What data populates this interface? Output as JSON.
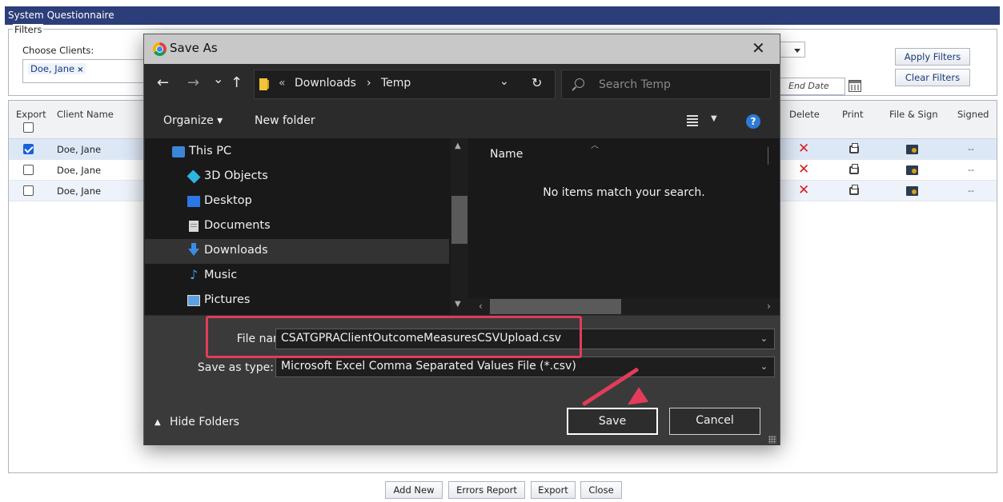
{
  "app": {
    "title": "System Questionnaire",
    "filters_legend": "Filters",
    "choose_clients_label": "Choose Clients:",
    "client_chip": "Doe, Jane",
    "chip_remove": "×",
    "end_date_placeholder": "End Date",
    "apply_filters": "Apply Filters",
    "clear_filters": "Clear Filters"
  },
  "grid": {
    "headers": {
      "export": "Export",
      "client_name": "Client Name",
      "delete": "Delete",
      "print": "Print",
      "file_sign": "File & Sign",
      "signed": "Signed"
    },
    "rows": [
      {
        "name": "Doe, Jane",
        "checked": true,
        "signed": "--"
      },
      {
        "name": "Doe, Jane",
        "checked": false,
        "signed": "--"
      },
      {
        "name": "Doe, Jane",
        "checked": false,
        "signed": "--"
      }
    ],
    "delete_glyph": "✕"
  },
  "bottom_buttons": {
    "add_new": "Add New",
    "errors_report": "Errors Report",
    "export": "Export",
    "close": "Close"
  },
  "dialog": {
    "title": "Save As",
    "close_glyph": "✕",
    "nav": {
      "back": "←",
      "forward": "→",
      "recent": "⌄",
      "up": "↑"
    },
    "breadcrumb": {
      "prefix": "«",
      "parts": [
        "Downloads",
        "Temp"
      ],
      "separator": "›"
    },
    "refresh_glyph": "↻",
    "address_dropdown": "⌄",
    "search_placeholder": "Search Temp",
    "toolbar": {
      "organize": "Organize ▾",
      "new_folder": "New folder",
      "help": "?"
    },
    "nav_items": [
      {
        "label": "This PC",
        "icon": "computer-icon"
      },
      {
        "label": "3D Objects",
        "icon": "3d-objects-icon"
      },
      {
        "label": "Desktop",
        "icon": "desktop-icon"
      },
      {
        "label": "Documents",
        "icon": "documents-icon"
      },
      {
        "label": "Downloads",
        "icon": "downloads-icon",
        "selected": true
      },
      {
        "label": "Music",
        "icon": "music-icon"
      },
      {
        "label": "Pictures",
        "icon": "pictures-icon"
      }
    ],
    "column_name": "Name",
    "empty_message": "No items match your search.",
    "file_name_label": "File name:",
    "file_name_value": "CSATGPRAClientOutcomeMeasuresCSVUpload.csv",
    "save_as_type_label": "Save as type:",
    "save_as_type_value": "Microsoft Excel Comma Separated Values File (*.csv)",
    "hide_folders": "Hide Folders",
    "save": "Save",
    "cancel": "Cancel"
  },
  "colors": {
    "app_titlebar": "#2c3e7a",
    "annotation": "#e23c5a",
    "dialog_bg": "#2b2b2b",
    "delete_red": "#d42020"
  }
}
